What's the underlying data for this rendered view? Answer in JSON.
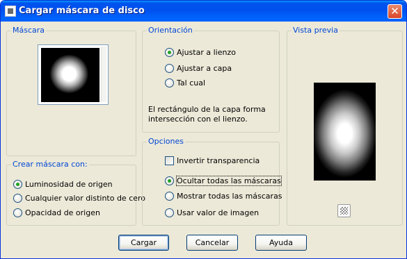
{
  "window": {
    "title": "Cargar máscara de disco",
    "close_glyph": "✕"
  },
  "mask_group": {
    "legend": "Máscara"
  },
  "create_group": {
    "legend": "Crear máscara con:",
    "options": [
      {
        "label": "Luminosidad de origen",
        "mnemonic_index": 0,
        "checked": true
      },
      {
        "label": "Cualquier valor distinto de cero",
        "mnemonic_index": 17,
        "checked": false
      },
      {
        "label": "Opacidad de origen",
        "mnemonic_index": 0,
        "checked": false
      }
    ]
  },
  "orientation_group": {
    "legend": "Orientación",
    "options": [
      {
        "label": "Ajustar a lienzo",
        "checked": true
      },
      {
        "label": "Ajustar a capa",
        "checked": false
      },
      {
        "label": "Tal cual",
        "checked": false
      }
    ],
    "description": "El rectángulo de la capa forma intersección con el lienzo."
  },
  "options_group": {
    "legend": "Opciones",
    "invert_label": "Invertir transparencia",
    "invert_checked": false,
    "radios": [
      {
        "label": "Ocultar todas las máscaras",
        "checked": true
      },
      {
        "label": "Mostrar todas las máscaras",
        "checked": false
      },
      {
        "label": "Usar valor de imagen",
        "checked": false
      }
    ]
  },
  "preview_group": {
    "legend": "Vista previa",
    "background_icon": "checkerboard-icon"
  },
  "buttons": {
    "ok": "Cargar",
    "cancel": "Cancelar",
    "help": "Ayuda"
  },
  "colors": {
    "titlebar": "#0053ee",
    "legend_text": "#0046d5",
    "dialog_bg": "#ece9d8",
    "radio_dot": "#21a121"
  }
}
